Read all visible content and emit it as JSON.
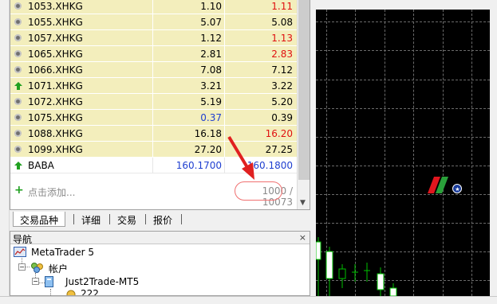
{
  "market_watch": {
    "rows": [
      {
        "icon": "dot-icon",
        "symbol": "1053.XHKG",
        "bid": "1.10",
        "ask": "1.11",
        "bid_color": "black",
        "ask_color": "red"
      },
      {
        "icon": "dot-icon",
        "symbol": "1055.XHKG",
        "bid": "5.07",
        "ask": "5.08",
        "bid_color": "black",
        "ask_color": "black"
      },
      {
        "icon": "dot-icon",
        "symbol": "1057.XHKG",
        "bid": "1.12",
        "ask": "1.13",
        "bid_color": "black",
        "ask_color": "red"
      },
      {
        "icon": "dot-icon",
        "symbol": "1065.XHKG",
        "bid": "2.81",
        "ask": "2.83",
        "bid_color": "black",
        "ask_color": "red"
      },
      {
        "icon": "dot-icon",
        "symbol": "1066.XHKG",
        "bid": "7.08",
        "ask": "7.12",
        "bid_color": "black",
        "ask_color": "black"
      },
      {
        "icon": "up-arrow-icon",
        "symbol": "1071.XHKG",
        "bid": "3.21",
        "ask": "3.22",
        "bid_color": "black",
        "ask_color": "black"
      },
      {
        "icon": "dot-icon",
        "symbol": "1072.XHKG",
        "bid": "5.19",
        "ask": "5.20",
        "bid_color": "black",
        "ask_color": "black"
      },
      {
        "icon": "dot-icon",
        "symbol": "1075.XHKG",
        "bid": "0.37",
        "ask": "0.39",
        "bid_color": "blue",
        "ask_color": "black"
      },
      {
        "icon": "dot-icon",
        "symbol": "1088.XHKG",
        "bid": "16.18",
        "ask": "16.20",
        "bid_color": "black",
        "ask_color": "red"
      },
      {
        "icon": "dot-icon",
        "symbol": "1099.XHKG",
        "bid": "27.20",
        "ask": "27.25",
        "bid_color": "black",
        "ask_color": "black"
      },
      {
        "icon": "up-arrow-icon",
        "symbol": "BABA",
        "bid": "160.1700",
        "ask": "160.1800",
        "bid_color": "blue",
        "ask_color": "blue",
        "plain": true
      }
    ],
    "add_label": "点击添加...",
    "count": "1000 / 10073"
  },
  "tabs": [
    "交易品种",
    "详细",
    "交易",
    "报价"
  ],
  "navigator": {
    "title": "导航",
    "close": "×",
    "items": {
      "root": "MetaTrader 5",
      "accounts": "帐户",
      "server": "Just2Trade-MT5",
      "account": "222"
    }
  },
  "colors": {
    "highlight_row": "#f3eebc",
    "bid_blue": "#1f3fd0",
    "ask_red": "#e01010",
    "candle_up": "#ffffff",
    "candle_down": "#00c000"
  }
}
